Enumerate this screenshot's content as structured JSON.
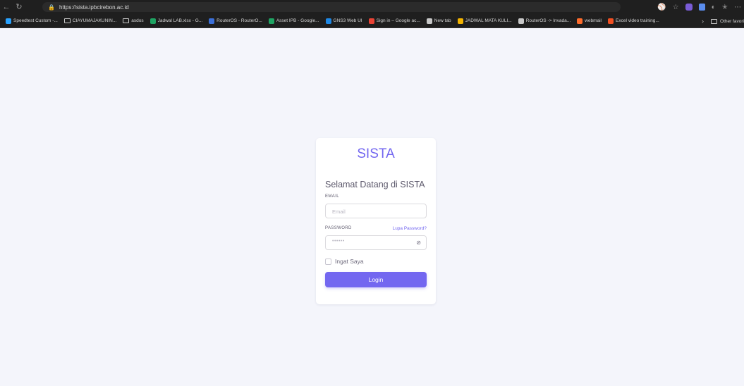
{
  "browser": {
    "url": "https://sista.ipbcirebon.ac.id",
    "bookmarks": [
      {
        "label": "Speedtest Custom -...",
        "icon": "globe-icon",
        "color": "#2aa3ff"
      },
      {
        "label": "CIAYUMAJAKUNIN...",
        "icon": "folder-icon",
        "color": "#c8c8c8"
      },
      {
        "label": "asdos",
        "icon": "folder-icon",
        "color": "#c8c8c8"
      },
      {
        "label": "Jadwal LAB.xlsx - G...",
        "icon": "sheets-icon",
        "color": "#1fa463"
      },
      {
        "label": "RouterOS - RouterO...",
        "icon": "routeros-icon",
        "color": "#3b6fd8"
      },
      {
        "label": "Asset IPB - Google...",
        "icon": "sheets-icon",
        "color": "#1fa463"
      },
      {
        "label": "GNS3 Web UI",
        "icon": "gns3-icon",
        "color": "#1e88e5"
      },
      {
        "label": "Sign in – Google ac...",
        "icon": "google-icon",
        "color": "#ea4335"
      },
      {
        "label": "New tab",
        "icon": "newtab-icon",
        "color": "#c8c8c8"
      },
      {
        "label": "JADWAL MATA KULI...",
        "icon": "drive-icon",
        "color": "#f4b400"
      },
      {
        "label": "RouterOS -> Invada...",
        "icon": "globe-icon",
        "color": "#c8c8c8"
      },
      {
        "label": "webmail",
        "icon": "cpanel-icon",
        "color": "#ff6c2c"
      },
      {
        "label": "Excel video training...",
        "icon": "microsoft-icon",
        "color": "#f25022"
      }
    ],
    "other_favorites": "Other favori"
  },
  "login": {
    "brand": "SISTA",
    "welcome": "Selamat Datang di SISTA",
    "email_label": "EMAIL",
    "email_placeholder": "Email",
    "password_label": "PASSWORD",
    "forgot_label": "Lupa Password?",
    "password_mask": "••••••",
    "remember_label": "Ingat Saya",
    "login_button": "Login"
  },
  "colors": {
    "accent": "#7367f0",
    "page_bg": "#f4f5fb",
    "chrome_bg": "#1f1f1f"
  }
}
